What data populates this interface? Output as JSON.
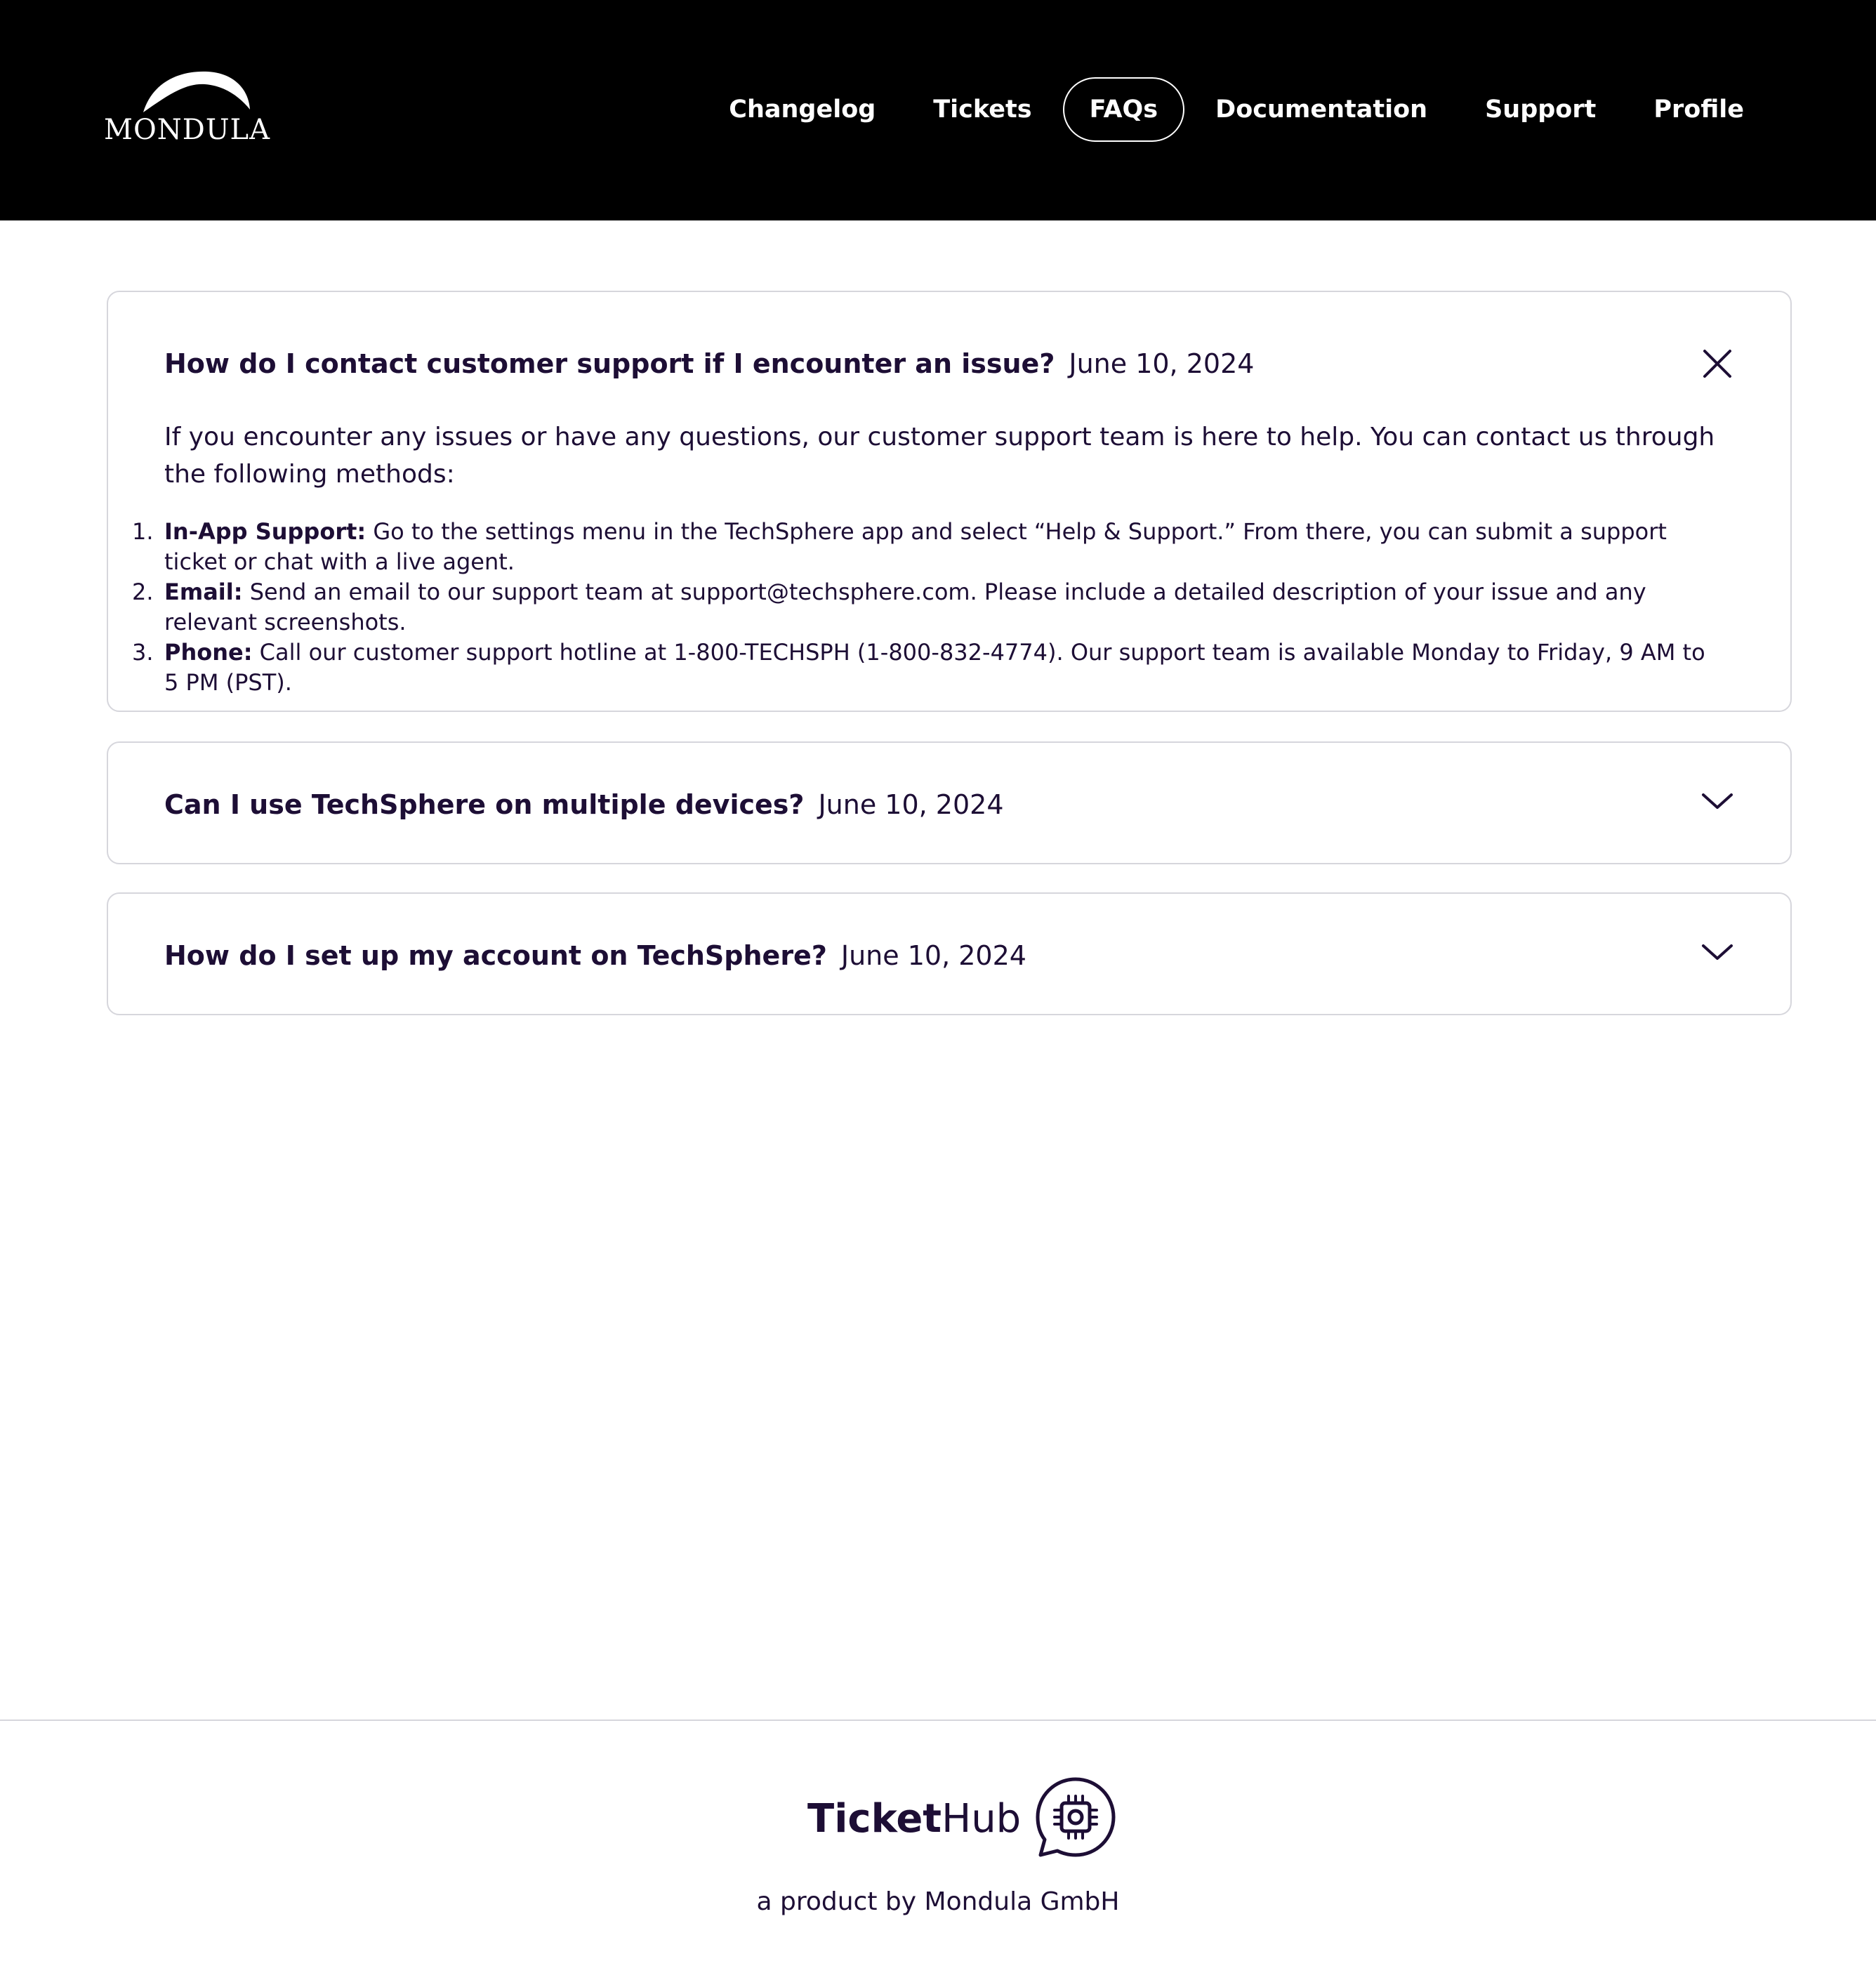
{
  "header": {
    "logo_text": "MONDULA",
    "nav": [
      "Changelog",
      "Tickets",
      "FAQs",
      "Documentation",
      "Support",
      "Profile"
    ],
    "active_nav": "FAQs"
  },
  "faqs": [
    {
      "question": "How do I contact customer support if I encounter an issue?",
      "date": "June 10, 2024",
      "expanded": true,
      "intro": "If you encounter any issues or have any questions, our customer support team is here to help. You can contact us through the following methods:",
      "steps": [
        {
          "num": "1.",
          "label": "In-App Support:",
          "text": "Go to the settings menu in the TechSphere app and select “Help & Support.” From there, you can submit a support ticket or chat with a live agent."
        },
        {
          "num": "2.",
          "label": "Email:",
          "text": "Send an email to our support team at support@techsphere.com. Please include a detailed description of your issue and any relevant screenshots."
        },
        {
          "num": "3.",
          "label": "Phone:",
          "text": "Call our customer support hotline at 1-800-TECHSPH (1-800-832-4774). Our support team is available Monday to Friday, 9 AM to 5 PM (PST)."
        }
      ]
    },
    {
      "question": "Can I use TechSphere on multiple devices?",
      "date": "June 10, 2024",
      "expanded": false
    },
    {
      "question": "How do I set up my account on TechSphere?",
      "date": "June 10, 2024",
      "expanded": false
    }
  ],
  "footer": {
    "brand_bold": "Ticket",
    "brand_regular": "Hub",
    "tagline": "a product by Mondula GmbH"
  },
  "icons": [
    "mondula-logo-icon",
    "close-icon",
    "chevron-down-icon",
    "tickethub-chip-icon"
  ],
  "colors": {
    "header_bg": "#000000",
    "text": "#1d0e35",
    "border": "#d6d6dc"
  }
}
